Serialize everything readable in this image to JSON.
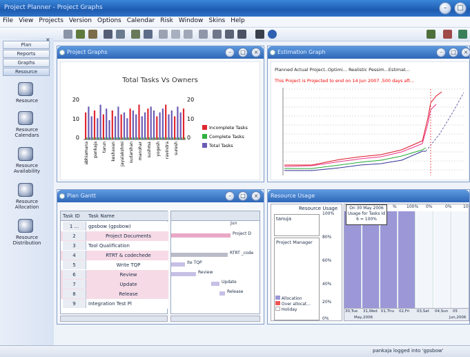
{
  "window": {
    "title": "Project Planner - Project Graphs"
  },
  "menu": [
    "File",
    "View",
    "Projects",
    "Version",
    "Options",
    "Calendar",
    "Risk",
    "Window",
    "Skins",
    "Help"
  ],
  "sidebar": {
    "tabs": [
      "Plan",
      "Reports",
      "Graphs",
      "Resource"
    ],
    "items": [
      {
        "label": "Resource",
        "icon": "resource-icon"
      },
      {
        "label": "Resource Calendars",
        "icon": "calendar-icon"
      },
      {
        "label": "Resource Availability",
        "icon": "availability-icon"
      },
      {
        "label": "Resource Allocation",
        "icon": "allocation-icon"
      },
      {
        "label": "Resource Distribution",
        "icon": "distribution-icon"
      }
    ]
  },
  "project_graphs": {
    "title": "Project Graphs",
    "chart_title": "Total Tasks Vs Owners",
    "legend": [
      "Incomplete Tasks",
      "Complete Tasks",
      "Total Tasks"
    ],
    "y_ticks": [
      "20",
      "10",
      "0"
    ],
    "y2_ticks": [
      "20",
      "10",
      "0"
    ],
    "owners": [
      "abhiamana",
      "pankaja",
      "tarun",
      "keshavan",
      "jayalakshmi",
      "sudarshan",
      "manohar",
      "sushma",
      "yogesh",
      "ravindra",
      "suresh"
    ],
    "colors": {
      "incomplete": "#e0262e",
      "complete": "#32b040",
      "total": "#6b5bb5"
    }
  },
  "estimation_graph": {
    "title": "Estimation Graph",
    "legend": "Planned Actual Project..Optimi... Realistic Pessim...Estimat...",
    "note": "This Project is Projected to end on 14 Jun 2007 ,500 days aft..."
  },
  "plan_gantt": {
    "title": "Plan Gantt",
    "col_id": "Task ID",
    "col_name": "Task Name",
    "timeline_label": "Jun",
    "rows": [
      {
        "id": "1 ...",
        "name": "gpsbow (gpsbow)",
        "bar": ""
      },
      {
        "id": "2",
        "name": "Project Documents",
        "bar": "Project D"
      },
      {
        "id": "3",
        "name": "Tool Qualification",
        "bar": ""
      },
      {
        "id": "4",
        "name": "RTRT & codechede",
        "bar": "RTRT _code"
      },
      {
        "id": "5",
        "name": "Write TQP",
        "bar": "ite TQP"
      },
      {
        "id": "6",
        "name": "Review",
        "bar": "Review"
      },
      {
        "id": "7",
        "name": "Update",
        "bar": "Update"
      },
      {
        "id": "8",
        "name": "Release",
        "bar": "Release"
      },
      {
        "id": "9",
        "name": "Integration Test Pl",
        "bar": ""
      }
    ]
  },
  "resource_usage": {
    "title": "Resource Usage",
    "header": "Resource Usage",
    "resource_name": "tanuja",
    "role": "Project Manager",
    "y_ticks": [
      "100%",
      "80%",
      "60%",
      "40%",
      "20%",
      "0%"
    ],
    "tooltip": [
      "On 30 May 2006",
      "Usage for Tasks Id",
      "6 = 100%"
    ],
    "top_pct": [
      "100%",
      "0%",
      "0%",
      "10"
    ],
    "top_first": "%",
    "legend": [
      "Allocation",
      "Over allocat...",
      "Holiday"
    ],
    "days": [
      "30,Tue",
      "31,Wed",
      "01,Thu",
      "02,Fri",
      "03,Sat",
      "04,Sun",
      "05"
    ],
    "month_left": "May,2006",
    "month_right": "Jun,2006",
    "usage": [
      1,
      1,
      1,
      1,
      0,
      0,
      0
    ]
  },
  "statusbar": {
    "text": "pankaja logged into 'gpsbow'"
  }
}
